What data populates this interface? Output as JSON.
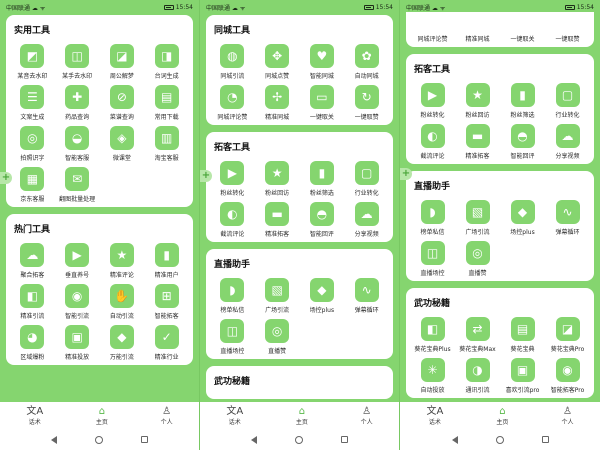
{
  "colors": {
    "accent": "#85d56f",
    "card": "#ffffff",
    "active_tab": "#59b94a"
  },
  "status": {
    "carrier": "中国联通 ☁ ᯤ",
    "time": "15:54"
  },
  "screens": [
    {
      "cards": [
        {
          "title": "实用工具",
          "items": [
            {
              "label": "某音去水印",
              "icon": "◩"
            },
            {
              "label": "某手去水印",
              "icon": "◫"
            },
            {
              "label": "周公解梦",
              "icon": "◪"
            },
            {
              "label": "台词生成",
              "icon": "◨"
            },
            {
              "label": "文案生成",
              "icon": "☰"
            },
            {
              "label": "药品查询",
              "icon": "✚"
            },
            {
              "label": "菜谱查询",
              "icon": "⊘"
            },
            {
              "label": "常用下载",
              "icon": "▤"
            },
            {
              "label": "拍照识字",
              "icon": "◎"
            },
            {
              "label": "智能客服",
              "icon": "◒"
            },
            {
              "label": "微课堂",
              "icon": "◈"
            },
            {
              "label": "淘宝客服",
              "icon": "▥"
            },
            {
              "label": "京东客服",
              "icon": "▦"
            },
            {
              "label": "翻图批量处理",
              "icon": "✉"
            }
          ]
        },
        {
          "title": "热门工具",
          "items": [
            {
              "label": "聚合拓客",
              "icon": "☁"
            },
            {
              "label": "垂直养号",
              "icon": "▶"
            },
            {
              "label": "精准评论",
              "icon": "★"
            },
            {
              "label": "精准用户",
              "icon": "▮"
            },
            {
              "label": "精准引流",
              "icon": "◧"
            },
            {
              "label": "智能引流",
              "icon": "◉"
            },
            {
              "label": "自动引流",
              "icon": "✋"
            },
            {
              "label": "智能拓客",
              "icon": "⊞"
            },
            {
              "label": "区域爆粉",
              "icon": "◕"
            },
            {
              "label": "精准投放",
              "icon": "▣"
            },
            {
              "label": "万能引流",
              "icon": "◆"
            },
            {
              "label": "精准行业",
              "icon": "✓"
            }
          ]
        }
      ]
    },
    {
      "cards": [
        {
          "title": "同城工具",
          "items": [
            {
              "label": "同城引流",
              "icon": "◍"
            },
            {
              "label": "同城点赞",
              "icon": "✥"
            },
            {
              "label": "智能同城",
              "icon": "♥"
            },
            {
              "label": "自动同城",
              "icon": "✿"
            },
            {
              "label": "同城评论赞",
              "icon": "◔"
            },
            {
              "label": "精准同城",
              "icon": "✢"
            },
            {
              "label": "一键取关",
              "icon": "▭"
            },
            {
              "label": "一键取赞",
              "icon": "↻"
            }
          ]
        },
        {
          "title": "拓客工具",
          "items": [
            {
              "label": "粉丝转化",
              "icon": "▶"
            },
            {
              "label": "粉丝回访",
              "icon": "★"
            },
            {
              "label": "粉丝筛选",
              "icon": "▮"
            },
            {
              "label": "行业转化",
              "icon": "▢"
            },
            {
              "label": "截流评论",
              "icon": "◐"
            },
            {
              "label": "精准拓客",
              "icon": "▬"
            },
            {
              "label": "智能回评",
              "icon": "◓"
            },
            {
              "label": "分享视频",
              "icon": "☁"
            }
          ]
        },
        {
          "title": "直播助手",
          "items": [
            {
              "label": "榜单私信",
              "icon": "◗"
            },
            {
              "label": "广场引流",
              "icon": "▧"
            },
            {
              "label": "场控plus",
              "icon": "◆"
            },
            {
              "label": "弹幕循环",
              "icon": "∿"
            },
            {
              "label": "直播场控",
              "icon": "◫"
            },
            {
              "label": "直播赞",
              "icon": "◎"
            }
          ]
        },
        {
          "title": "武功秘籍",
          "items": []
        }
      ]
    },
    {
      "cards": [
        {
          "title": "",
          "items": [
            {
              "label": "同城评论赞",
              "icon": ""
            },
            {
              "label": "精准同城",
              "icon": ""
            },
            {
              "label": "一键取关",
              "icon": ""
            },
            {
              "label": "一键取赞",
              "icon": ""
            }
          ]
        },
        {
          "title": "拓客工具",
          "items": [
            {
              "label": "粉丝转化",
              "icon": "▶"
            },
            {
              "label": "粉丝回访",
              "icon": "★"
            },
            {
              "label": "粉丝筛选",
              "icon": "▮"
            },
            {
              "label": "行业转化",
              "icon": "▢"
            },
            {
              "label": "截流评论",
              "icon": "◐"
            },
            {
              "label": "精准拓客",
              "icon": "▬"
            },
            {
              "label": "智能回评",
              "icon": "◓"
            },
            {
              "label": "分享视频",
              "icon": "☁"
            }
          ]
        },
        {
          "title": "直播助手",
          "items": [
            {
              "label": "榜单私信",
              "icon": "◗"
            },
            {
              "label": "广场引流",
              "icon": "▧"
            },
            {
              "label": "场控plus",
              "icon": "◆"
            },
            {
              "label": "弹幕循环",
              "icon": "∿"
            },
            {
              "label": "直播场控",
              "icon": "◫"
            },
            {
              "label": "直播赞",
              "icon": "◎"
            }
          ]
        },
        {
          "title": "武功秘籍",
          "items": [
            {
              "label": "葵花宝典Plus",
              "icon": "◧"
            },
            {
              "label": "葵花宝典Max",
              "icon": "⇄"
            },
            {
              "label": "葵花宝典",
              "icon": "▤"
            },
            {
              "label": "葵花宝典Pro",
              "icon": "◪"
            },
            {
              "label": "自动投放",
              "icon": "✳"
            },
            {
              "label": "通讯引流",
              "icon": "◑"
            },
            {
              "label": "喜欢引流pro",
              "icon": "▣"
            },
            {
              "label": "智能拓客Pro",
              "icon": "◉"
            }
          ]
        }
      ]
    }
  ],
  "tabbar": [
    {
      "label": "话术",
      "icon": "文A"
    },
    {
      "label": "主页",
      "icon": "⌂"
    },
    {
      "label": "个人",
      "icon": "♙"
    }
  ]
}
